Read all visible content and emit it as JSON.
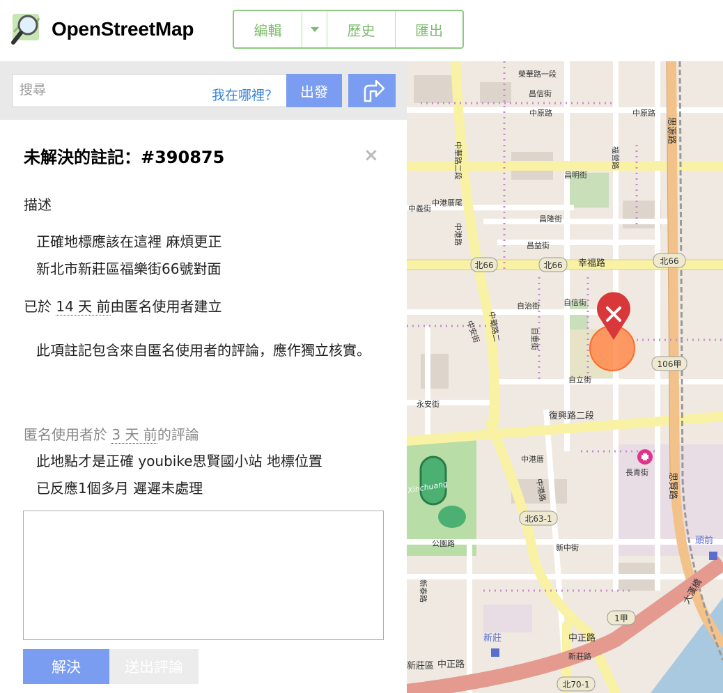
{
  "header": {
    "brand": "OpenStreetMap",
    "nav": {
      "edit": "編輯",
      "history": "歷史",
      "export": "匯出"
    }
  },
  "search": {
    "placeholder": "搜尋",
    "where_am_i": "我在哪裡？",
    "go": "出發"
  },
  "note": {
    "title": "未解決的註記：#390875",
    "close_symbol": "×",
    "description_heading": "描述",
    "description_lines": [
      "正確地標應該在這裡 麻煩更正",
      "新北市新莊區福樂街66號對面"
    ],
    "created_prefix": "已於 ",
    "created_ago": "14 天 前",
    "created_suffix": "由匿名使用者建立",
    "warning": "此項註記包含來自匿名使用者的評論，應作獨立核實。",
    "comment_prefix": "匿名使用者於 ",
    "comment_ago": "3 天 前",
    "comment_suffix": "的評論",
    "comment_lines": [
      "此地點才是正確 youbike思賢國小站 地標位置",
      "已反應1個多月 遲遲未處理"
    ],
    "resolve_label": "解決",
    "submit_comment_label": "送出評論"
  },
  "map": {
    "street_labels": [
      "榮華路一段",
      "中原路",
      "中原路",
      "昌信街",
      "中華路二段",
      "中港厝尾",
      "中義街",
      "中港路",
      "昌明街",
      "福營路",
      "昌隆街",
      "昌益街",
      "幸福路",
      "自治街",
      "自信街",
      "自重街",
      "中安街",
      "中華路二",
      "自立街",
      "永安街",
      "復興路二段",
      "中港厝",
      "中港路",
      "長青街",
      "新中街",
      "公園路",
      "新泰路",
      "中正路",
      "中正路",
      "新莊",
      "新莊區",
      "新莊路",
      "思源路",
      "思賢路",
      "頭前",
      "大漢橋"
    ],
    "route_shields": [
      "北66",
      "北66",
      "北66",
      "106甲",
      "北63-1",
      "1甲",
      "北70-1"
    ],
    "park_label": "Xinchuang",
    "colors": {
      "marker": "#d9383a",
      "circle": "#ff8a4c",
      "route_road": "#f9f2a4",
      "main_road": "#e59a8f"
    }
  }
}
